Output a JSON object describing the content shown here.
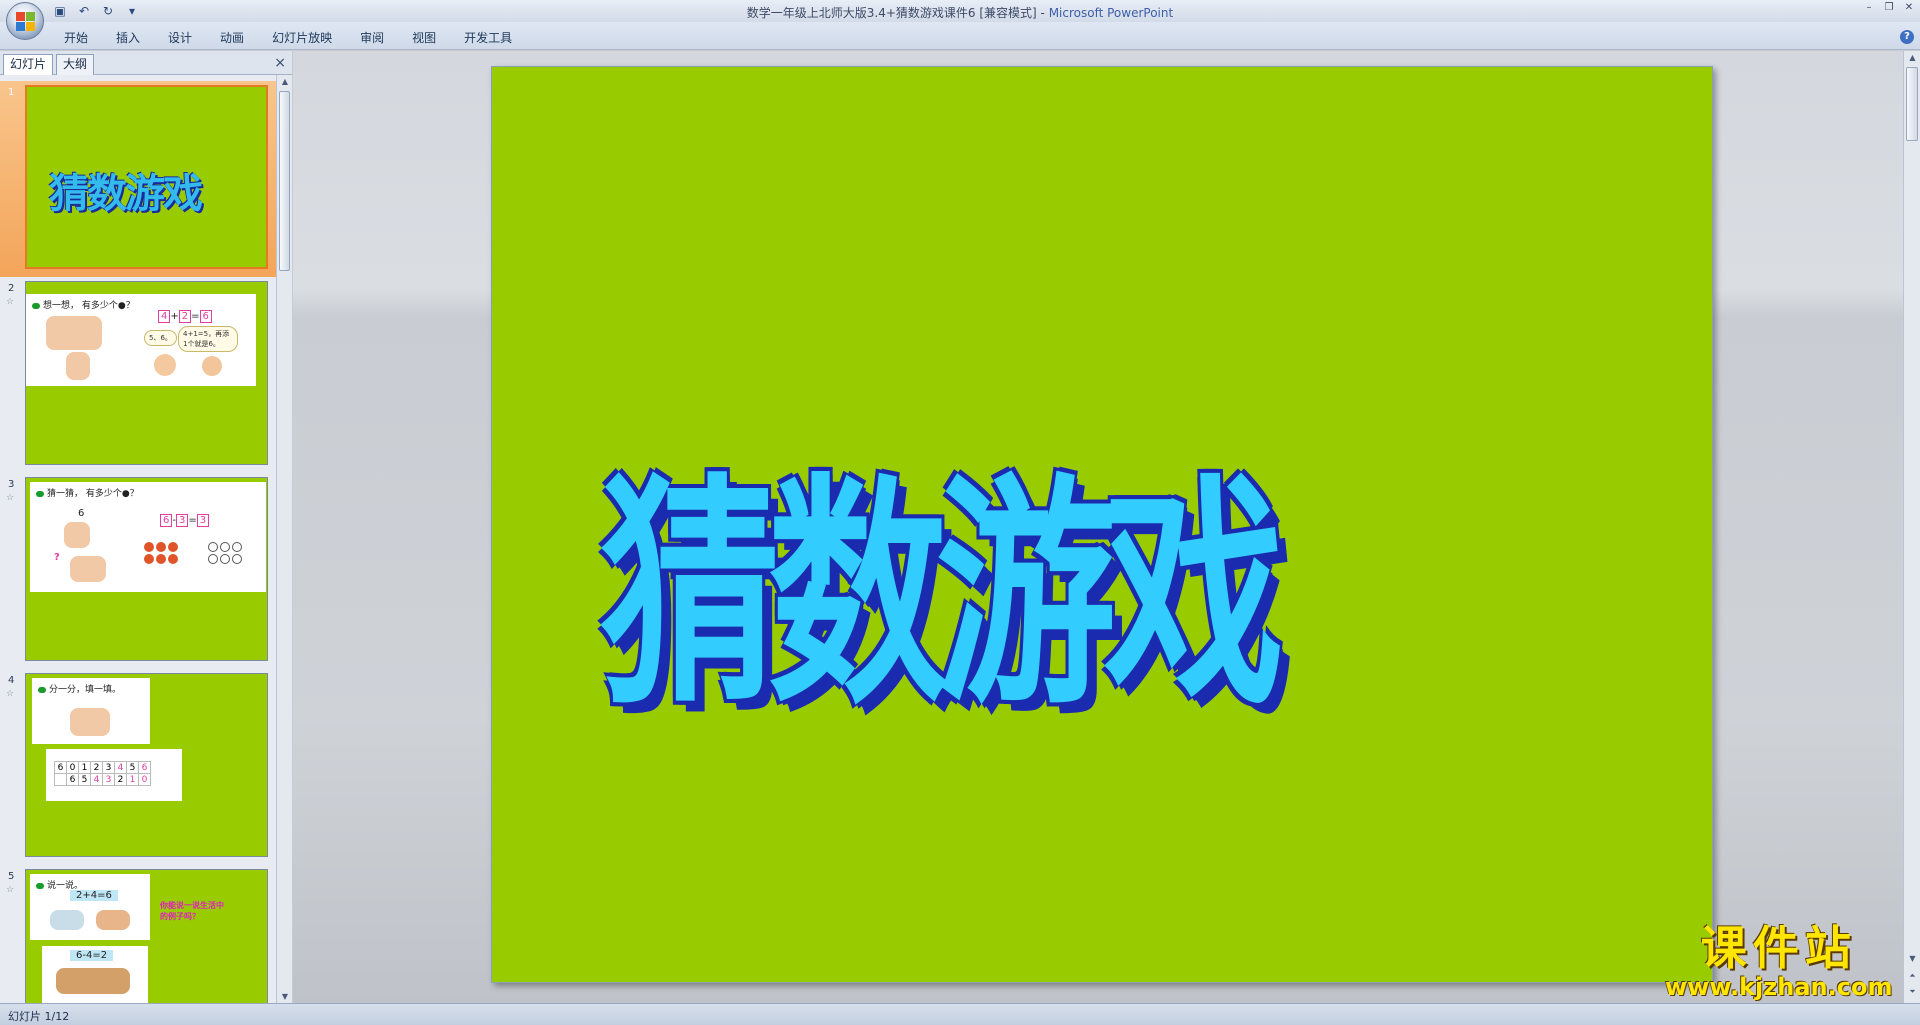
{
  "window": {
    "title": "数学一年级上北师大版3.4+猜数游戏课件6 [兼容模式]",
    "title_sep": " - ",
    "app_name": "Microsoft PowerPoint"
  },
  "ribbon": {
    "tabs": [
      "开始",
      "插入",
      "设计",
      "动画",
      "幻灯片放映",
      "审阅",
      "视图",
      "开发工具"
    ]
  },
  "left_pane": {
    "tabs": [
      "幻灯片",
      "大纲"
    ],
    "close_glyph": "×"
  },
  "thumbnails": [
    {
      "num": "1",
      "title": "猜数游戏"
    },
    {
      "num": "2",
      "caption": "想一想， 有多少个●？",
      "eq": [
        "4",
        "+",
        "2",
        "=",
        "6"
      ],
      "bubble1": "5、6。",
      "bubble2": "4+1=5，再添1个就是6。"
    },
    {
      "num": "3",
      "caption": "猜一猜， 有多少个●？",
      "top_num": "6",
      "question": "?",
      "eq": [
        "6",
        "-",
        "3",
        "=",
        "3"
      ]
    },
    {
      "num": "4",
      "caption": "分一分，填一填。",
      "row1": [
        "6",
        "0",
        "1",
        "2",
        "3",
        "4",
        "5",
        "6"
      ],
      "row2": [
        "",
        "6",
        "5",
        "4",
        "3",
        "2",
        "1",
        "0"
      ]
    },
    {
      "num": "5",
      "caption": "说一说。",
      "eq1": "2+4=6",
      "eq2": "6-4=2",
      "note1": "你能说一说生活中",
      "note2": "的例子吗？"
    }
  ],
  "slide": {
    "title": "猜数游戏",
    "background": "#99cc00",
    "title_color": "#33ccff",
    "title_shadow": "#1a2bb0"
  },
  "watermark": {
    "text": "课件站",
    "url": "www.kjzhan.com"
  },
  "status": {
    "text": "幻灯片 1/12"
  }
}
